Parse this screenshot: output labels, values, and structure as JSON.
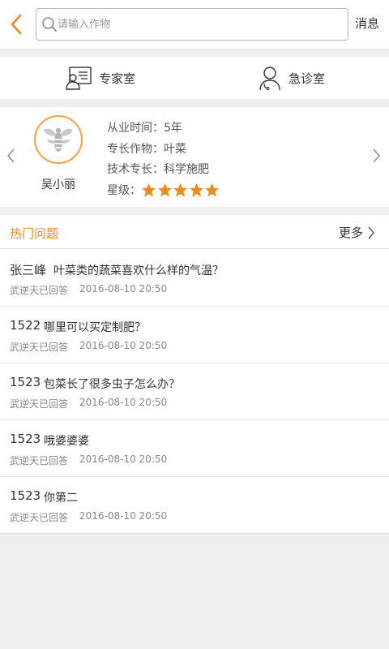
{
  "header": {
    "search_placeholder": "请输入作物",
    "message_label": "消息"
  },
  "rooms": {
    "expert_label": "专家室",
    "emergency_label": "急诊室"
  },
  "expert": {
    "name": "吴小丽",
    "experience_label": "从业时间：",
    "experience_value": "5年",
    "crop_label": "专长作物：",
    "crop_value": "叶菜",
    "skill_label": "技术专长：",
    "skill_value": "科学施肥",
    "rating_label": "星级：",
    "rating": 5
  },
  "hot_questions": {
    "title": "热门问题",
    "more_label": "更多",
    "items": [
      {
        "user": "张三峰",
        "question": "叶菜类的蔬菜喜欢什么样的气温？",
        "answered_by": "武逆天已回答",
        "time": "2016-08-10 20:50"
      },
      {
        "user": "1522",
        "question": "哪里可以买定制肥？",
        "answered_by": "武逆天已回答",
        "time": "2016-08-10 20:50"
      },
      {
        "user": "1523",
        "question": "包菜长了很多虫子怎么办？",
        "answered_by": "武逆天已回答",
        "time": "2016-08-10 20:50"
      },
      {
        "user": "1523",
        "question": "哦婆婆婆",
        "answered_by": "武逆天已回答",
        "time": "2016-08-10 20:50"
      },
      {
        "user": "1523",
        "question": "你第二",
        "answered_by": "武逆天已回答",
        "time": "2016-08-10 20:50"
      }
    ]
  },
  "colors": {
    "accent": "#f08a1a",
    "star": "#f08a1a",
    "background": "#efefef"
  }
}
